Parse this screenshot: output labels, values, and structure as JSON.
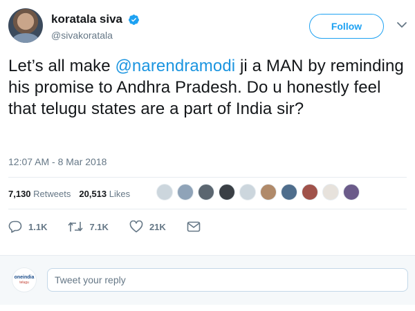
{
  "user": {
    "display_name": "koratala siva",
    "handle": "@sivakoratala",
    "verified": true
  },
  "header": {
    "follow_label": "Follow",
    "menu_icon": "chevron-down-icon"
  },
  "tweet": {
    "text_part1": "Let’s all make ",
    "mention": "@narendramodi",
    "text_part2": " ji a MAN by reminding his promise to Andhra Pradesh. Do u honestly feel that telugu states are a part of India sir?",
    "timestamp": "12:07 AM - 8 Mar 2018"
  },
  "stats": {
    "retweets_count": "7,130",
    "retweets_label": "Retweets",
    "likes_count": "20,513",
    "likes_label": "Likes",
    "liker_avatars": [
      "avatar-1",
      "avatar-2",
      "avatar-3",
      "avatar-4",
      "avatar-5",
      "avatar-6",
      "avatar-7",
      "avatar-8",
      "avatar-9",
      "avatar-10"
    ]
  },
  "actions": {
    "reply_count": "1.1K",
    "retweet_count": "7.1K",
    "like_count": "21K",
    "message_icon": "envelope-icon"
  },
  "reply": {
    "avatar_brand_top": "oneindia",
    "avatar_brand_bottom": "telugu",
    "placeholder": "Tweet your reply"
  },
  "colors": {
    "accent": "#1da1f2",
    "mention": "#1b95e0",
    "muted": "#657786",
    "text": "#14171a",
    "divider": "#e6ecf0",
    "reply_bg": "#f5f8fa"
  }
}
